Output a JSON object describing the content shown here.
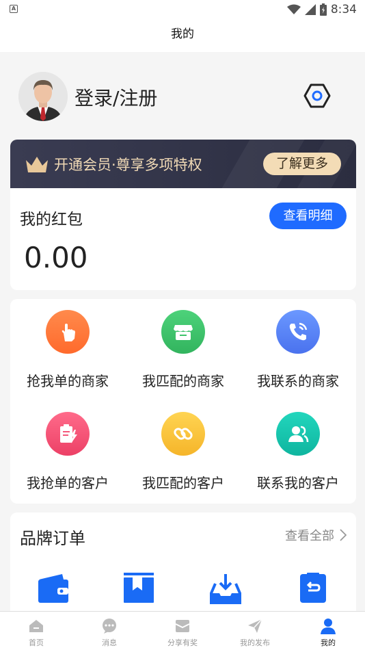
{
  "status": {
    "time": "8:34",
    "left_badge": "A"
  },
  "header": {
    "title": "我的"
  },
  "profile": {
    "login_label": "登录/注册"
  },
  "vip": {
    "text": "开通会员·尊享多项特权",
    "button": "了解更多"
  },
  "hongbao": {
    "title": "我的红包",
    "button": "查看明细",
    "value": "0.00"
  },
  "grid": [
    {
      "label": "抢我单的商家",
      "icon": "hand-tap-icon",
      "color": "#ff7a3d"
    },
    {
      "label": "我匹配的商家",
      "icon": "store-icon",
      "color": "#3ec36a"
    },
    {
      "label": "我联系的商家",
      "icon": "phone-call-icon",
      "color": "#5b82f6"
    },
    {
      "label": "我抢单的客户",
      "icon": "clipboard-flash-icon",
      "color": "#f5577a"
    },
    {
      "label": "我匹配的客户",
      "icon": "link-icon",
      "color": "#f7c23c"
    },
    {
      "label": "联系我的客户",
      "icon": "contacts-icon",
      "color": "#18c8b0"
    }
  ],
  "brand": {
    "title": "品牌订单",
    "more": "查看全部",
    "icons": [
      "wallet-icon",
      "bookmark-icon",
      "download-box-icon",
      "return-icon"
    ],
    "accent": "#1a6bf5"
  },
  "tabs": [
    {
      "label": "首页",
      "icon": "home-icon"
    },
    {
      "label": "消息",
      "icon": "message-icon"
    },
    {
      "label": "分享有奖",
      "icon": "gift-icon"
    },
    {
      "label": "我的发布",
      "icon": "send-icon"
    },
    {
      "label": "我的",
      "icon": "user-icon",
      "active": true
    }
  ],
  "colors": {
    "primary": "#1f6bff",
    "vip_bg": "#333548",
    "vip_gold": "#f3dcb6"
  }
}
